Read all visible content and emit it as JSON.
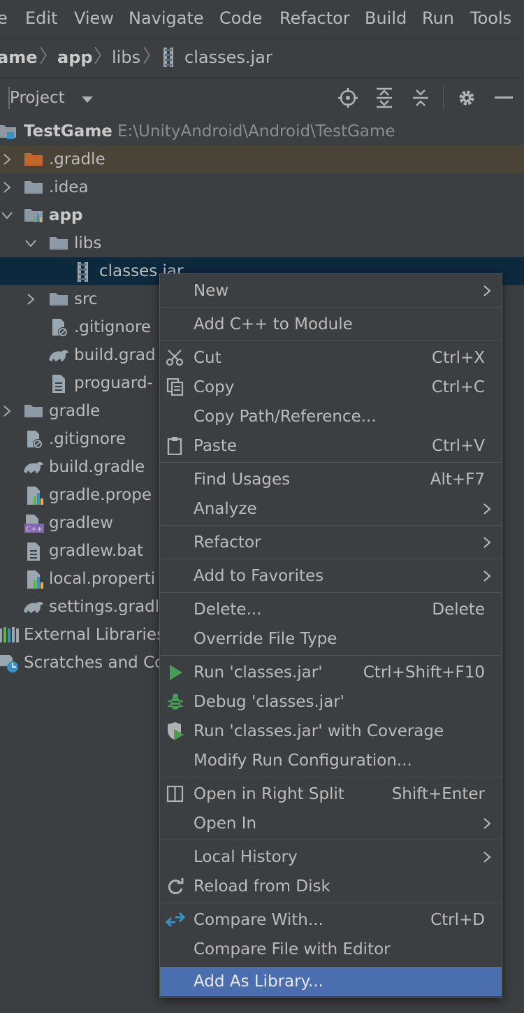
{
  "menubar": {
    "items": [
      "e",
      "Edit",
      "View",
      "Navigate",
      "Code",
      "Refactor",
      "Build",
      "Run",
      "Tools"
    ]
  },
  "breadcrumb": {
    "items": [
      "ame",
      "app",
      "libs",
      "classes.jar"
    ]
  },
  "project_panel": {
    "title": "Project"
  },
  "tree": {
    "root_name": "TestGame",
    "root_path": "E:\\UnityAndroid\\Android\\TestGame",
    "items": [
      ".gradle",
      ".idea",
      "app",
      "libs",
      "classes.jar",
      "src",
      ".gitignore",
      "build.grad",
      "proguard-",
      "gradle",
      ".gitignore",
      "build.gradle",
      "gradle.prope",
      "gradlew",
      "gradlew.bat",
      "local.properti",
      "settings.gradl",
      "External Libraries",
      "Scratches and Co"
    ]
  },
  "context_menu": {
    "items": [
      {
        "label": "New",
        "shortcut": ""
      },
      {
        "label": "Add C++ to Module",
        "shortcut": ""
      },
      {
        "label": "Cut",
        "shortcut": "Ctrl+X"
      },
      {
        "label": "Copy",
        "shortcut": "Ctrl+C"
      },
      {
        "label": "Copy Path/Reference...",
        "shortcut": ""
      },
      {
        "label": "Paste",
        "shortcut": "Ctrl+V"
      },
      {
        "label": "Find Usages",
        "shortcut": "Alt+F7"
      },
      {
        "label": "Analyze",
        "shortcut": ""
      },
      {
        "label": "Refactor",
        "shortcut": ""
      },
      {
        "label": "Add to Favorites",
        "shortcut": ""
      },
      {
        "label": "Delete...",
        "shortcut": "Delete"
      },
      {
        "label": "Override File Type",
        "shortcut": ""
      },
      {
        "label": "Run 'classes.jar'",
        "shortcut": "Ctrl+Shift+F10"
      },
      {
        "label": "Debug 'classes.jar'",
        "shortcut": ""
      },
      {
        "label": "Run 'classes.jar' with Coverage",
        "shortcut": ""
      },
      {
        "label": "Modify Run Configuration...",
        "shortcut": ""
      },
      {
        "label": "Open in Right Split",
        "shortcut": "Shift+Enter"
      },
      {
        "label": "Open In",
        "shortcut": ""
      },
      {
        "label": "Local History",
        "shortcut": ""
      },
      {
        "label": "Reload from Disk",
        "shortcut": ""
      },
      {
        "label": "Compare With...",
        "shortcut": "Ctrl+D"
      },
      {
        "label": "Compare File with Editor",
        "shortcut": ""
      },
      {
        "label": "Add As Library...",
        "shortcut": ""
      }
    ]
  },
  "icons": [
    "locate-icon",
    "expand-all-icon",
    "collapse-all-icon",
    "gear-icon",
    "minimize-icon",
    "folder-icon",
    "module-icon",
    "jar-icon",
    "gradle-icon",
    "file-icon",
    "cut-icon",
    "copy-icon",
    "paste-icon",
    "run-icon",
    "debug-icon",
    "coverage-icon",
    "split-icon",
    "reload-icon",
    "compare-icon"
  ],
  "colors": {
    "background": "#3c3f41",
    "selection": "#0d293e",
    "menu_highlight": "#4b6eaf",
    "text": "#bbbbbb",
    "excluded_folder_bg": "#4a4337"
  }
}
